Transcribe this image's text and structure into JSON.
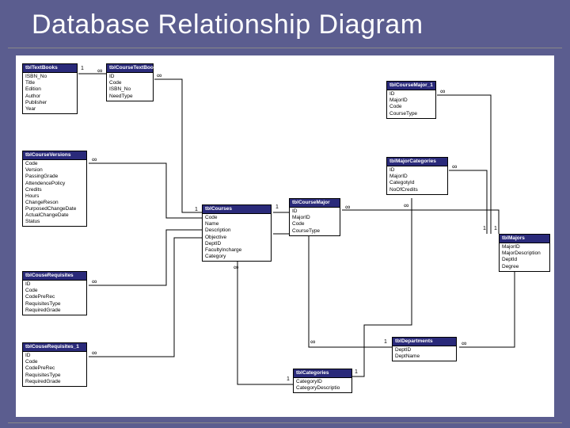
{
  "title": "Database Relationship Diagram",
  "tables": {
    "tblTextBooks": {
      "name": "tblTextBooks",
      "fields": [
        "ISBN_No",
        "Title",
        "Edition",
        "Author",
        "Publisher",
        "Year"
      ]
    },
    "tblCourseTextBooks": {
      "name": "tblCourseTextBooks",
      "fields": [
        "ID",
        "Code",
        "ISBN_No",
        "NeedType"
      ]
    },
    "tblCourseMajor_1": {
      "name": "tblCourseMajor_1",
      "fields": [
        "ID",
        "MajorID",
        "Code",
        "CourseType"
      ]
    },
    "tblCourseVersions": {
      "name": "tblCourseVersions",
      "fields": [
        "Code",
        "Version",
        "PassingGrade",
        "AttendencePolicy",
        "Credits",
        "Hours",
        "ChangeReson",
        "PurposedChangeDate",
        "ActualChangeDate",
        "Status"
      ]
    },
    "tblMajorCategories": {
      "name": "tblMajorCategories",
      "fields": [
        "ID",
        "MajorID",
        "CategotyId",
        "NoOfCredits"
      ]
    },
    "tblCourses": {
      "name": "tblCourses",
      "fields": [
        "Code",
        "Name",
        "Description",
        "Objective",
        "DeptID",
        "FacultyIncharge",
        "Category"
      ]
    },
    "tblCourseMajor": {
      "name": "tblCourseMajor",
      "fields": [
        "ID",
        "MajorID",
        "Code",
        "CourseType"
      ]
    },
    "tblMajors": {
      "name": "tblMajors",
      "fields": [
        "MajorID",
        "MajorDescription",
        "DeptId",
        "Degree"
      ]
    },
    "tblCouseRequisites": {
      "name": "tblCouseRequisites",
      "fields": [
        "ID",
        "Code",
        "CodePreRec",
        "RequisitesType",
        "RequiredGrade"
      ]
    },
    "tblDepartments": {
      "name": "tblDepartments",
      "fields": [
        "DeptID",
        "DeptName"
      ]
    },
    "tblCouseRequisites_1": {
      "name": "tblCouseRequisites_1",
      "fields": [
        "ID",
        "Code",
        "CodePreRec",
        "RequisitesType",
        "RequiredGrade"
      ]
    },
    "tblCategories": {
      "name": "tblCategories",
      "fields": [
        "CategoryID",
        "CategoryDescriptio"
      ]
    }
  },
  "cardinality": {
    "one": "1",
    "many": "∞"
  }
}
